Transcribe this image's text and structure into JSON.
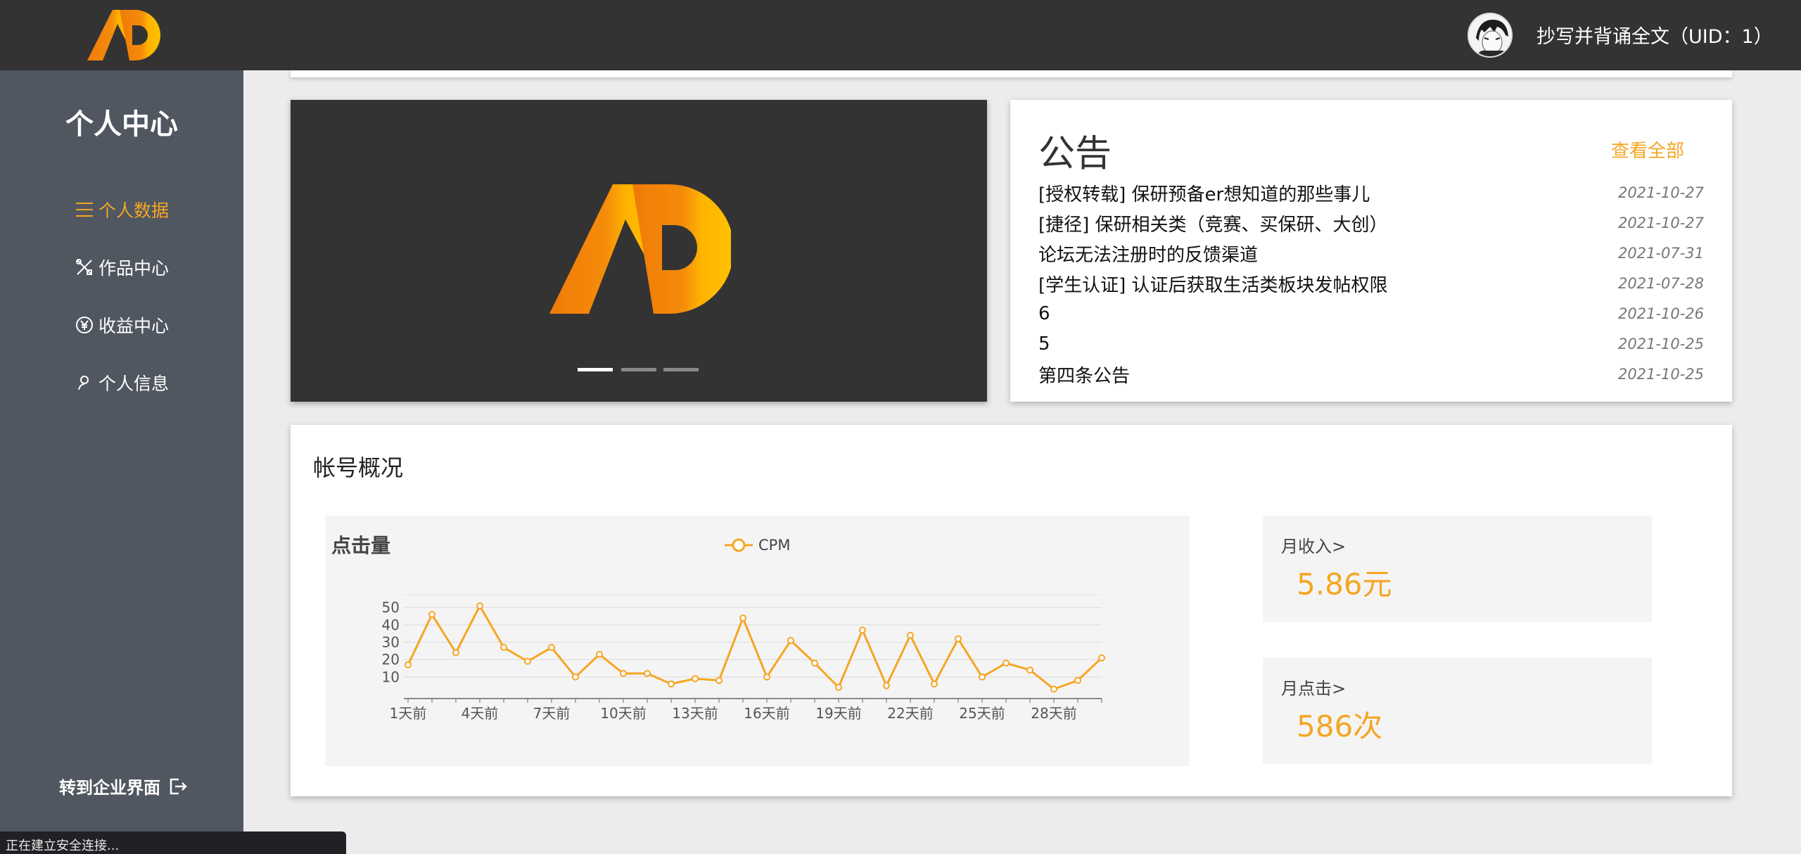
{
  "header": {
    "username": "抄写并背诵全文（UID：1）"
  },
  "sidebar": {
    "title": "个人中心",
    "items": [
      {
        "label": "个人数据",
        "icon": "menu-icon"
      },
      {
        "label": "作品中心",
        "icon": "tools-icon"
      },
      {
        "label": "收益中心",
        "icon": "yen-icon"
      },
      {
        "label": "个人信息",
        "icon": "user-icon"
      }
    ],
    "switch_label": "转到企业界面"
  },
  "notice": {
    "title": "公告",
    "view_all": "查看全部",
    "items": [
      {
        "title": "[授权转载] 保研预备er想知道的那些事儿",
        "date": "2021-10-27"
      },
      {
        "title": "[捷径] 保研相关类（竞赛、买保研、大创）",
        "date": "2021-10-27"
      },
      {
        "title": "论坛无法注册时的反馈渠道",
        "date": "2021-07-31"
      },
      {
        "title": "[学生认证] 认证后获取生活类板块发帖权限",
        "date": "2021-07-28"
      },
      {
        "title": "6",
        "date": "2021-10-26"
      },
      {
        "title": "5",
        "date": "2021-10-25"
      },
      {
        "title": "第四条公告",
        "date": "2021-10-25"
      }
    ]
  },
  "overview": {
    "title": "帐号概况",
    "monthly_income_label": "月收入>",
    "monthly_income_value": "5.86元",
    "monthly_clicks_label": "月点击>",
    "monthly_clicks_value": "586次"
  },
  "chart_data": {
    "type": "line",
    "title": "点击量",
    "series": [
      {
        "name": "CPM",
        "values": [
          17,
          46,
          24,
          51,
          27,
          19,
          27,
          10,
          23,
          12,
          12,
          6,
          9,
          8,
          44,
          10,
          31,
          18,
          4,
          37,
          5,
          34,
          6,
          32,
          10,
          18,
          14,
          3,
          8,
          21
        ]
      }
    ],
    "x": [
      "1天前",
      "2天前",
      "3天前",
      "4天前",
      "5天前",
      "6天前",
      "7天前",
      "8天前",
      "9天前",
      "10天前",
      "11天前",
      "12天前",
      "13天前",
      "14天前",
      "15天前",
      "16天前",
      "17天前",
      "18天前",
      "19天前",
      "20天前",
      "21天前",
      "22天前",
      "23天前",
      "24天前",
      "25天前",
      "26天前",
      "27天前",
      "28天前",
      "29天前",
      "30天前"
    ],
    "x_tick_labels": [
      "1天前",
      "4天前",
      "7天前",
      "10天前",
      "13天前",
      "16天前",
      "19天前",
      "22天前",
      "25天前",
      "28天前"
    ],
    "y_ticks": [
      10,
      20,
      30,
      40,
      50
    ],
    "ylim": [
      0,
      60
    ],
    "color": "#f5a623",
    "legend_position": "top-center",
    "grid": true
  },
  "statusbar": {
    "text": "正在建立安全连接..."
  },
  "colors": {
    "accent": "#f5a623",
    "topbar": "#333333",
    "sidebar": "#505761"
  }
}
